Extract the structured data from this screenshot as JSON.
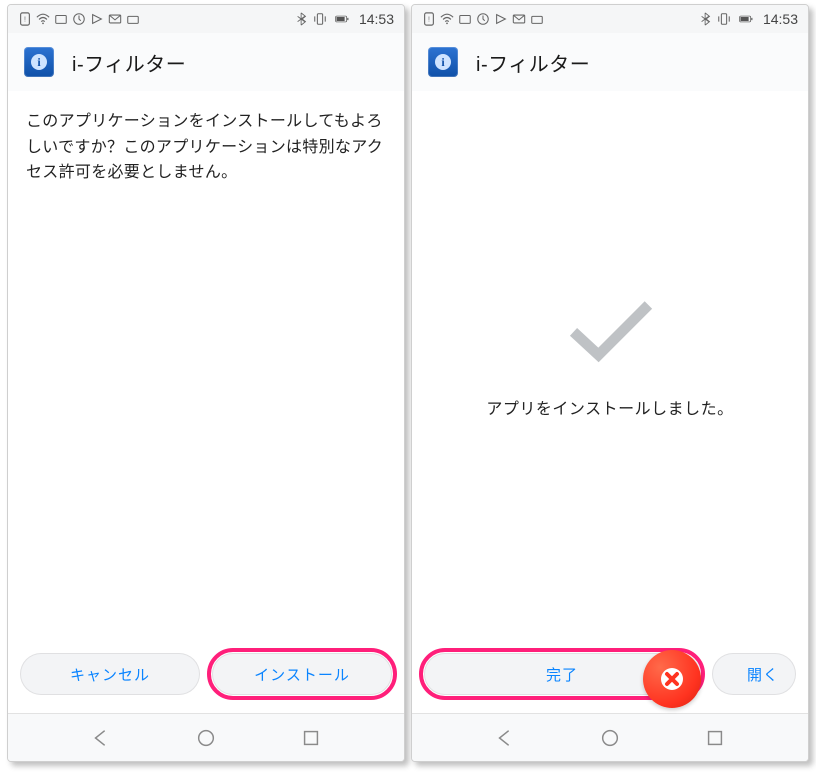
{
  "statusbar": {
    "time": "14:53"
  },
  "app": {
    "title": "i-フィルター",
    "icon_letter": "i"
  },
  "screen_left": {
    "message": "このアプリケーションをインストールしてもよろしいですか？このアプリケーションは特別なアクセス許可を必要としません。",
    "cancel_label": "キャンセル",
    "install_label": "インストール"
  },
  "screen_right": {
    "done_text": "アプリをインストールしました。",
    "done_label": "完了",
    "open_label": "開く"
  }
}
